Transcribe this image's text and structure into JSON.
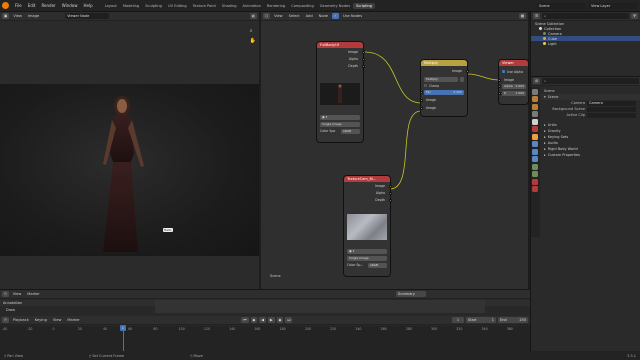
{
  "topbar": {
    "menus": [
      "File",
      "Edit",
      "Render",
      "Window",
      "Help"
    ],
    "workspaces": [
      "Layout",
      "Modeling",
      "Sculpting",
      "UV Editing",
      "Texture Paint",
      "Shading",
      "Animation",
      "Rendering",
      "Compositing",
      "Geometry Nodes",
      "Scripting"
    ],
    "active_workspace": "Compositing",
    "scene": "Scene",
    "view_layer": "View Layer"
  },
  "image_editor": {
    "header": {
      "view": "View",
      "image": "Image",
      "image_name": "Viewer Node"
    },
    "tooltip": "Hello"
  },
  "node_editor": {
    "header": {
      "menus": [
        "View",
        "Select",
        "Add",
        "Node"
      ],
      "use_nodes": "Use Nodes",
      "footer": "Scene"
    },
    "nodes": {
      "image1": {
        "title": "FullBody.tif",
        "outputs": [
          "Image",
          "Alpha",
          "Depth"
        ],
        "source": "Single Image",
        "color_space_label": "Color Spa",
        "color_space_value": "sRGB"
      },
      "mix": {
        "title": "Multiply",
        "output": "Image",
        "blend": "Multiply",
        "clamp": "Clamp",
        "fac_label": "Fac",
        "fac_value": "0.200",
        "inputs": [
          "Image",
          "Image"
        ]
      },
      "viewer": {
        "title": "Viewer",
        "use_alpha": "Use Alpha",
        "inputs": [
          "Image",
          "Alpha",
          "Z"
        ],
        "alpha_value": "1.000",
        "z_value": "1.000"
      },
      "image2": {
        "title": "TextureCam_Bl...",
        "outputs": [
          "Image",
          "Alpha",
          "Depth"
        ],
        "source": "Single Image",
        "color_space_label": "Color Sp...",
        "color_space_value": "sRGB"
      }
    }
  },
  "outliner": {
    "title": "Scene Collection",
    "items": [
      "Collection",
      "Camera",
      "Cube",
      "Light"
    ]
  },
  "properties": {
    "scene_header": "Scene",
    "panel": "Scene",
    "camera_label": "Camera",
    "camera_value": "Camera",
    "background_scene_label": "Background Scene",
    "active_clip_label": "Active Clip",
    "sections": [
      "Units",
      "Gravity",
      "Keying Sets",
      "Audio",
      "Rigid Body World",
      "Custom Properties"
    ]
  },
  "timeline": {
    "header": [
      "Playback",
      "Keying",
      "View",
      "Marker"
    ],
    "start_label": "Start",
    "start_value": "1",
    "end_label": "End",
    "end_value": "250",
    "current_frame": "1",
    "ticks": [
      "-40",
      "-20",
      "0",
      "20",
      "40",
      "60",
      "80",
      "100",
      "120",
      "140",
      "160",
      "180",
      "200",
      "220",
      "240",
      "260",
      "280",
      "300",
      "320",
      "340",
      "360"
    ],
    "summary": "Summary",
    "dope_rows": [
      "Annotation",
      "Draw"
    ]
  },
  "statusbar": {
    "items": [
      "Pan View",
      "Set Current Frame",
      "Move"
    ],
    "version": "3.3.1"
  },
  "colors": {
    "accent": "#4772b3",
    "node_red": "#b33b3b",
    "node_yellow": "#b9a142",
    "socket_yellow": "#c7c729",
    "blender_orange": "#e87d0d",
    "playhead": "#4772b3"
  }
}
